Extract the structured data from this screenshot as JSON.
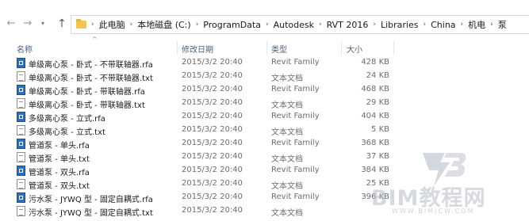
{
  "address": {
    "crumbs": [
      "此电脑",
      "本地磁盘 (C:)",
      "ProgramData",
      "Autodesk",
      "RVT 2016",
      "Libraries",
      "China",
      "机电",
      "泵"
    ]
  },
  "columns": {
    "name": "名称",
    "date": "修改日期",
    "type": "类型",
    "size": "大小"
  },
  "files": [
    {
      "name": "单级离心泵 - 卧式 - 不带联轴器.rfa",
      "date": "2015/3/2 20:40",
      "type": "Revit Family",
      "size": "428 KB",
      "icon": "rfa"
    },
    {
      "name": "单级离心泵 - 卧式 - 不带联轴器.txt",
      "date": "2015/3/2 20:40",
      "type": "文本文档",
      "size": "24 KB",
      "icon": "txt"
    },
    {
      "name": "单级离心泵 - 卧式 - 带联轴器.rfa",
      "date": "2015/3/2 20:40",
      "type": "Revit Family",
      "size": "468 KB",
      "icon": "rfa"
    },
    {
      "name": "单级离心泵 - 卧式 - 带联轴器.txt",
      "date": "2015/3/2 20:40",
      "type": "文本文档",
      "size": "29 KB",
      "icon": "txt"
    },
    {
      "name": "多级离心泵 - 立式.rfa",
      "date": "2015/3/2 20:40",
      "type": "Revit Family",
      "size": "404 KB",
      "icon": "rfa"
    },
    {
      "name": "多级离心泵 - 立式.txt",
      "date": "2015/3/2 20:40",
      "type": "文本文档",
      "size": "5 KB",
      "icon": "txt"
    },
    {
      "name": "管道泵 - 单头.rfa",
      "date": "2015/3/2 20:40",
      "type": "Revit Family",
      "size": "368 KB",
      "icon": "rfa"
    },
    {
      "name": "管道泵 - 单头.txt",
      "date": "2015/3/2 20:40",
      "type": "文本文档",
      "size": "37 KB",
      "icon": "txt"
    },
    {
      "name": "管道泵 - 双头.rfa",
      "date": "2015/3/2 20:40",
      "type": "Revit Family",
      "size": "384 KB",
      "icon": "rfa"
    },
    {
      "name": "管道泵 - 双头.txt",
      "date": "2015/3/2 20:40",
      "type": "文本文档",
      "size": "25 KB",
      "icon": "txt"
    },
    {
      "name": "污水泵 - JYWQ 型 - 固定自耦式.rfa",
      "date": "2015/3/2 20:40",
      "type": "Revit Family",
      "size": "396 KB",
      "icon": "rfa"
    },
    {
      "name": "污水泵 - JYWQ 型 - 固定自耦式.txt",
      "date": "2015/3/2 20:40",
      "type": "文本文档",
      "size": "",
      "icon": "txt"
    }
  ],
  "watermark": {
    "brand": "BIM教程网",
    "url": "WWW.BIMJCW.COM"
  }
}
